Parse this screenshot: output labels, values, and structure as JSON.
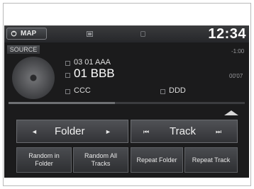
{
  "statusbar": {
    "map_label": "MAP",
    "clock": "12:34"
  },
  "source": {
    "label": "SOURCE"
  },
  "now_playing": {
    "folder": "03 01 AAA",
    "title": "01 BBB",
    "artist": "CCC",
    "album": "DDD",
    "elapsed": "-1:00",
    "remaining": "00'07",
    "progress": 0.45
  },
  "controls": {
    "folder_label": "Folder",
    "track_label": "Track"
  },
  "buttons": {
    "random_folder": "Random in Folder",
    "random_all": "Random All Tracks",
    "repeat_folder": "Repeat Folder",
    "repeat_track": "Repeat Track"
  }
}
